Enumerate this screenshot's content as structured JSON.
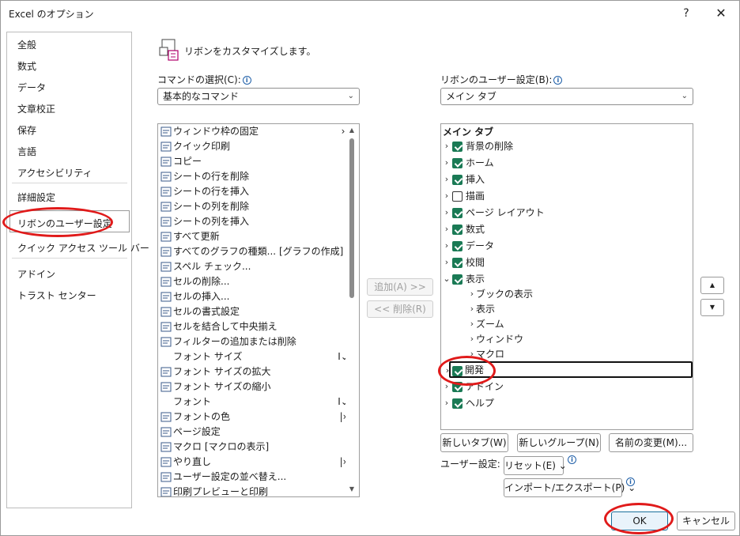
{
  "window": {
    "title": "Excel のオプション",
    "help": "?",
    "close": "✕"
  },
  "nav": {
    "items": [
      {
        "label": "全般"
      },
      {
        "label": "数式"
      },
      {
        "label": "データ"
      },
      {
        "label": "文章校正"
      },
      {
        "label": "保存"
      },
      {
        "label": "言語"
      },
      {
        "label": "アクセシビリティ"
      },
      {
        "label": "詳細設定"
      },
      {
        "label": "リボンのユーザー設定"
      },
      {
        "label": "クイック アクセス ツール バー"
      },
      {
        "label": "アドイン"
      },
      {
        "label": "トラスト センター"
      }
    ],
    "selected": "リボンのユーザー設定"
  },
  "header": {
    "text": "リボンをカスタマイズします。"
  },
  "commands": {
    "label": "コマンドの選択(C):",
    "combo_value": "基本的なコマンド",
    "items": [
      {
        "label": "ウィンドウ枠の固定",
        "right": "›",
        "icon": "freeze-panes-icon"
      },
      {
        "label": "クイック印刷",
        "right": "",
        "icon": "quick-print-icon"
      },
      {
        "label": "コピー",
        "right": "",
        "icon": "copy-icon"
      },
      {
        "label": "シートの行を削除",
        "right": "",
        "icon": "delete-row-icon"
      },
      {
        "label": "シートの行を挿入",
        "right": "",
        "icon": "insert-row-icon"
      },
      {
        "label": "シートの列を削除",
        "right": "",
        "icon": "delete-column-icon"
      },
      {
        "label": "シートの列を挿入",
        "right": "",
        "icon": "insert-column-icon"
      },
      {
        "label": "すべて更新",
        "right": "",
        "icon": "refresh-all-icon"
      },
      {
        "label": "すべてのグラフの種類... [グラフの作成]",
        "right": "",
        "icon": "chart-icon"
      },
      {
        "label": "スペル チェック...",
        "right": "",
        "icon": "spell-check-icon"
      },
      {
        "label": "セルの削除...",
        "right": "",
        "icon": "delete-cells-icon"
      },
      {
        "label": "セルの挿入...",
        "right": "",
        "icon": "insert-cells-icon"
      },
      {
        "label": "セルの書式設定",
        "right": "",
        "icon": "format-cells-icon"
      },
      {
        "label": "セルを結合して中央揃え",
        "right": "",
        "icon": "merge-center-icon"
      },
      {
        "label": "フィルターの追加または削除",
        "right": "",
        "icon": "filter-icon"
      },
      {
        "label": "フォント サイズ",
        "right": "I⌄",
        "icon": ""
      },
      {
        "label": "フォント サイズの拡大",
        "right": "",
        "icon": "font-grow-icon"
      },
      {
        "label": "フォント サイズの縮小",
        "right": "",
        "icon": "font-shrink-icon"
      },
      {
        "label": "フォント",
        "right": "I⌄",
        "icon": ""
      },
      {
        "label": "フォントの色",
        "right": "|›",
        "icon": "font-color-icon"
      },
      {
        "label": "ページ設定",
        "right": "",
        "icon": "page-setup-icon"
      },
      {
        "label": "マクロ [マクロの表示]",
        "right": "",
        "icon": "macro-icon"
      },
      {
        "label": "やり直し",
        "right": "|›",
        "icon": "redo-icon"
      },
      {
        "label": "ユーザー設定の並べ替え...",
        "right": "",
        "icon": "custom-sort-icon"
      },
      {
        "label": "印刷プレビューと印刷",
        "right": "",
        "icon": "print-preview-icon"
      }
    ]
  },
  "middle": {
    "add": "追加(A) >>",
    "remove": "<< 削除(R)"
  },
  "ribbon": {
    "label": "リボンのユーザー設定(B):",
    "combo_value": "メイン タブ",
    "tree_header": "メイン タブ",
    "tabs": [
      {
        "label": "背景の削除",
        "checked": true,
        "expanded": false
      },
      {
        "label": "ホーム",
        "checked": true,
        "expanded": false
      },
      {
        "label": "挿入",
        "checked": true,
        "expanded": false
      },
      {
        "label": "描画",
        "checked": false,
        "expanded": false
      },
      {
        "label": "ページ レイアウト",
        "checked": true,
        "expanded": false
      },
      {
        "label": "数式",
        "checked": true,
        "expanded": false
      },
      {
        "label": "データ",
        "checked": true,
        "expanded": false
      },
      {
        "label": "校閲",
        "checked": true,
        "expanded": false
      },
      {
        "label": "表示",
        "checked": true,
        "expanded": true
      }
    ],
    "groups": [
      "ブックの表示",
      "表示",
      "ズーム",
      "ウィンドウ",
      "マクロ"
    ],
    "tabs_after": [
      {
        "label": "開発",
        "checked": true,
        "selected": true
      },
      {
        "label": "アドイン",
        "checked": true,
        "selected": false
      },
      {
        "label": "ヘルプ",
        "checked": true,
        "selected": false
      }
    ],
    "new_tab": "新しいタブ(W)",
    "new_group": "新しいグループ(N)",
    "rename": "名前の変更(M)...",
    "user_settings_label": "ユーザー設定:",
    "reset": "リセット(E) ⌄",
    "import_export": "インポート/エクスポート(P) ⌄"
  },
  "footer": {
    "ok": "OK",
    "cancel": "キャンセル"
  },
  "colors": {
    "annotation": "#e01a1a",
    "checkbox": "#1a7a55"
  }
}
